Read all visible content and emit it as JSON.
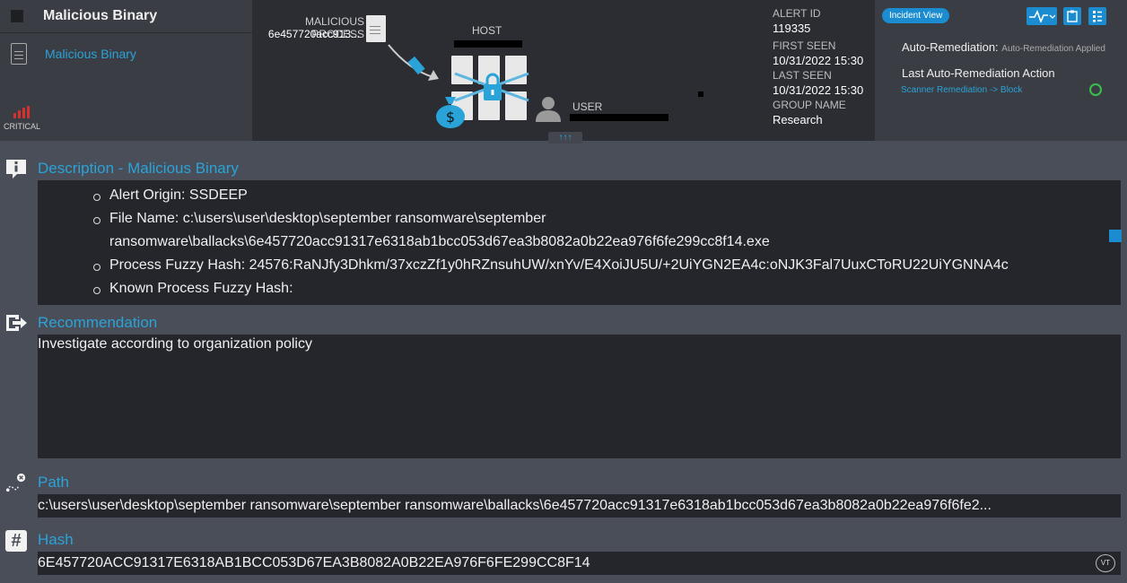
{
  "header": {
    "title": "Malicious Binary",
    "item_link": "Malicious Binary",
    "severity_label": "CRITICAL"
  },
  "graph": {
    "process_label": "MALICIOUS PROCESS",
    "process_value": "6e457720acc913...",
    "host_label": "HOST",
    "user_label": "USER"
  },
  "alert_info": {
    "alert_id_label": "ALERT ID",
    "alert_id": "119335",
    "first_seen_label": "FIRST SEEN",
    "first_seen": "10/31/2022 15:30",
    "last_seen_label": "LAST SEEN",
    "last_seen": "10/31/2022 15:30",
    "group_label": "GROUP NAME",
    "group": "Research"
  },
  "right_panel": {
    "incident_view": "Incident View",
    "auto_remediation_label": "Auto-Remediation:",
    "auto_remediation_value": "Auto-Remediation Applied",
    "last_action_label": "Last Auto-Remediation Action",
    "last_action_value": "Scanner Remediation -> Block"
  },
  "description": {
    "title": "Description - Malicious Binary",
    "items": [
      "Alert Origin: SSDEEP",
      "File Name: c:\\users\\user\\desktop\\september ransomware\\september ransomware\\ballacks\\6e457720acc91317e6318ab1bcc053d67ea3b8082a0b22ea976f6fe299cc8f14.exe",
      "Process Fuzzy Hash: 24576:RaNJfy3Dhkm/37xczZf1y0hRZnsuhUW/xnYv/E4XoiJU5U/+2UiYGN2EA4c:oNJK3Fal7UuxCToRU22UiYGNNA4c",
      "Known Process Fuzzy Hash:"
    ]
  },
  "recommendation": {
    "title": "Recommendation",
    "text": "Investigate according to organization policy"
  },
  "path": {
    "title": "Path",
    "value": "c:\\users\\user\\desktop\\september ransomware\\september ransomware\\ballacks\\6e457720acc91317e6318ab1bcc053d67ea3b8082a0b22ea976f6fe2..."
  },
  "hash": {
    "title": "Hash",
    "value": "6E457720ACC91317E6318AB1BCC053D67EA3B8082A0B22EA976F6FE299CC8F14",
    "vt_label": "VT"
  }
}
